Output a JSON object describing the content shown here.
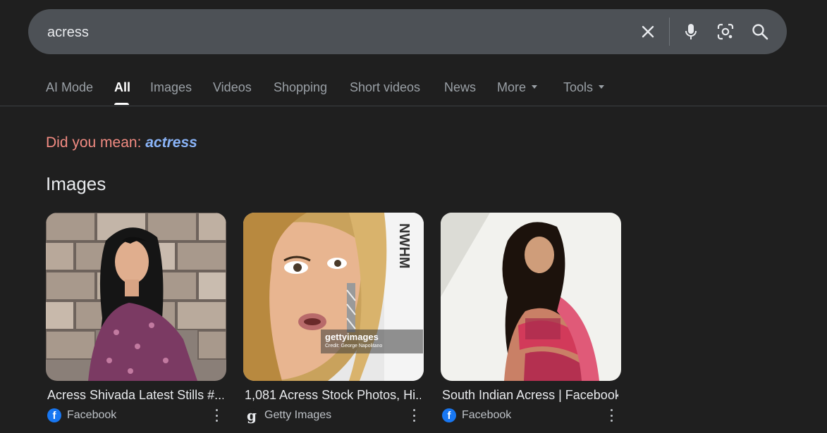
{
  "search": {
    "query": "acress"
  },
  "tabs": [
    {
      "label": "AI Mode"
    },
    {
      "label": "All"
    },
    {
      "label": "Images"
    },
    {
      "label": "Videos"
    },
    {
      "label": "Shopping"
    },
    {
      "label": "Short videos"
    },
    {
      "label": "News"
    },
    {
      "label": "More"
    },
    {
      "label": "Tools"
    }
  ],
  "active_tab": "All",
  "did_you_mean": {
    "prefix": "Did you mean:",
    "suggestion": "actress"
  },
  "images_section": {
    "title": "Images",
    "cards": [
      {
        "title": "Acress Shivada Latest Stills #...",
        "source": "Facebook",
        "favicon": "facebook-icon",
        "favicon_text": "f"
      },
      {
        "title": "1,081 Acress Stock Photos, Hi...",
        "source": "Getty Images",
        "favicon": "getty-icon",
        "favicon_text": "g",
        "watermark": "gettyimages",
        "watermark_credit": "Credit: George Napolitano",
        "sign_text": "NWHM"
      },
      {
        "title": "South Indian Acress | Facebook",
        "source": "Facebook",
        "favicon": "facebook-icon",
        "favicon_text": "f"
      }
    ]
  },
  "colors": {
    "background": "#1f1f1f",
    "search_bar": "#4d5156",
    "suggestion_link": "#8ab4f8",
    "did_you_mean": "#f28b82"
  }
}
